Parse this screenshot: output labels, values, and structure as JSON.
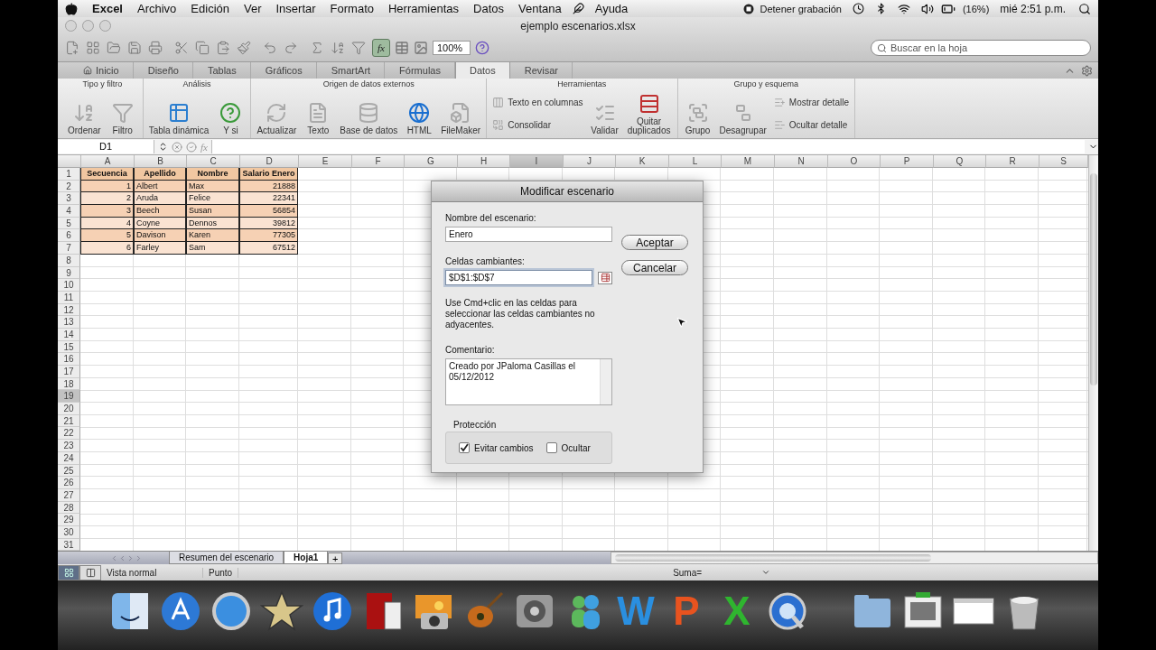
{
  "menu_bar": {
    "app": "Excel",
    "items": [
      "Archivo",
      "Edición",
      "Ver",
      "Insertar",
      "Formato",
      "Herramientas",
      "Datos",
      "Ventana",
      "Ayuda"
    ],
    "recording": "Detener grabación",
    "battery": "(16%)",
    "clock": "mié 2:51 p.m."
  },
  "window": {
    "title": "ejemplo escenarios.xlsx",
    "fx_label": "fx",
    "fx_pressed": true,
    "zoom": "100%",
    "search": {
      "placeholder": "Buscar en la hoja"
    }
  },
  "ribbon_tabs": [
    {
      "label": "Inicio",
      "selected": false
    },
    {
      "label": "Diseño",
      "selected": false
    },
    {
      "label": "Tablas",
      "selected": false
    },
    {
      "label": "Gráficos",
      "selected": false
    },
    {
      "label": "SmartArt",
      "selected": false
    },
    {
      "label": "Fórmulas",
      "selected": false
    },
    {
      "label": "Datos",
      "selected": true
    },
    {
      "label": "Revisar",
      "selected": false
    }
  ],
  "ribbon_groups": [
    {
      "title": "Tipo y filtro",
      "buttons": [
        {
          "label": "Ordenar",
          "kind": "large"
        },
        {
          "label": "Filtro",
          "kind": "large"
        }
      ]
    },
    {
      "title": "Análisis",
      "buttons": [
        {
          "label": "Tabla dinámica",
          "kind": "large"
        },
        {
          "label": "Y si",
          "kind": "large"
        }
      ]
    },
    {
      "title": "Origen de datos externos",
      "buttons": [
        {
          "label": "Actualizar",
          "kind": "large"
        },
        {
          "label": "Texto",
          "kind": "large"
        },
        {
          "label": "Base de datos",
          "kind": "large"
        },
        {
          "label": "HTML",
          "kind": "large"
        },
        {
          "label": "FileMaker",
          "kind": "large"
        }
      ]
    },
    {
      "title": "Herramientas",
      "buttons": [
        {
          "label": "Texto en columnas",
          "kind": "small"
        },
        {
          "label": "Consolidar",
          "kind": "small"
        },
        {
          "label": "Validar",
          "kind": "large"
        },
        {
          "label": "Quitar duplicados",
          "kind": "large"
        }
      ]
    },
    {
      "title": "Grupo y esquema",
      "buttons": [
        {
          "label": "Grupo",
          "kind": "large"
        },
        {
          "label": "Desagrupar",
          "kind": "large"
        },
        {
          "label": "Mostrar detalle",
          "kind": "small"
        },
        {
          "label": "Ocultar detalle",
          "kind": "small"
        }
      ]
    }
  ],
  "formula_bar": {
    "cell_ref": "D1",
    "fx_label": "fx"
  },
  "sheet": {
    "columns": [
      {
        "label": "A",
        "selected": false
      },
      {
        "label": "B",
        "selected": false
      },
      {
        "label": "C",
        "selected": false
      },
      {
        "label": "D",
        "selected": false
      },
      {
        "label": "E",
        "selected": false
      },
      {
        "label": "F",
        "selected": false
      },
      {
        "label": "G",
        "selected": false
      },
      {
        "label": "H",
        "selected": false
      },
      {
        "label": "I",
        "selected": true
      },
      {
        "label": "J",
        "selected": false
      },
      {
        "label": "K",
        "selected": false
      },
      {
        "label": "L",
        "selected": false
      },
      {
        "label": "M",
        "selected": false
      },
      {
        "label": "N",
        "selected": false
      },
      {
        "label": "O",
        "selected": false
      },
      {
        "label": "P",
        "selected": false
      },
      {
        "label": "Q",
        "selected": false
      },
      {
        "label": "R",
        "selected": false
      },
      {
        "label": "S",
        "selected": false
      }
    ],
    "row_headers": [
      {
        "label": "1",
        "selected": false
      },
      {
        "label": "2",
        "selected": false
      },
      {
        "label": "3",
        "selected": false
      },
      {
        "label": "4",
        "selected": false
      },
      {
        "label": "5",
        "selected": false
      },
      {
        "label": "6",
        "selected": false
      },
      {
        "label": "7",
        "selected": false
      },
      {
        "label": "8",
        "selected": false
      },
      {
        "label": "9",
        "selected": false
      },
      {
        "label": "10",
        "selected": false
      },
      {
        "label": "11",
        "selected": false
      },
      {
        "label": "12",
        "selected": false
      },
      {
        "label": "13",
        "selected": false
      },
      {
        "label": "14",
        "selected": false
      },
      {
        "label": "15",
        "selected": false
      },
      {
        "label": "16",
        "selected": false
      },
      {
        "label": "17",
        "selected": false
      },
      {
        "label": "18",
        "selected": false
      },
      {
        "label": "19",
        "selected": true
      },
      {
        "label": "20",
        "selected": false
      },
      {
        "label": "21",
        "selected": false
      },
      {
        "label": "22",
        "selected": false
      },
      {
        "label": "23",
        "selected": false
      },
      {
        "label": "24",
        "selected": false
      },
      {
        "label": "25",
        "selected": false
      },
      {
        "label": "26",
        "selected": false
      },
      {
        "label": "27",
        "selected": false
      },
      {
        "label": "28",
        "selected": false
      },
      {
        "label": "29",
        "selected": false
      },
      {
        "label": "30",
        "selected": false
      },
      {
        "label": "31",
        "selected": false
      }
    ],
    "table": {
      "columns": [
        "Secuencia",
        "Apellido",
        "Nombre",
        "Salario Enero"
      ],
      "rows": [
        [
          "1",
          "Albert",
          "Max",
          "21888"
        ],
        [
          "2",
          "Aruda",
          "Felice",
          "22341"
        ],
        [
          "3",
          "Beech",
          "Susan",
          "56854"
        ],
        [
          "4",
          "Coyne",
          "Dennos",
          "39812"
        ],
        [
          "5",
          "Davison",
          "Karen",
          "77305"
        ],
        [
          "6",
          "Farley",
          "Sam",
          "67512"
        ]
      ]
    }
  },
  "dialog": {
    "title": "Modificar escenario",
    "name_label": "Nombre del escenario:",
    "name_value": "Enero",
    "cells_label": "Celdas cambiantes:",
    "cells_value": "$D$1:$D$7",
    "hint": "Use Cmd+clic en las celdas para seleccionar las celdas cambiantes no adyacentes.",
    "comment_label": "Comentario:",
    "comment_value": "Creado por JPaloma Casillas el 05/12/2012",
    "protection_label": "Protección",
    "options": [
      {
        "label": "Evitar cambios",
        "checked": true
      },
      {
        "label": "Ocultar",
        "checked": false
      }
    ],
    "buttons": [
      "Aceptar",
      "Cancelar"
    ]
  },
  "sheet_tabs": [
    {
      "label": "Resumen del escenario",
      "selected": false
    },
    {
      "label": "Hoja1",
      "selected": true
    }
  ],
  "add_sheet": "+",
  "status_bar": {
    "view": "Vista normal",
    "mode": "Punto",
    "sum": "Suma="
  },
  "dock": [
    {
      "kind": "finder"
    },
    {
      "kind": "appstore"
    },
    {
      "kind": "safari"
    },
    {
      "kind": "star"
    },
    {
      "kind": "music"
    },
    {
      "kind": "curtain"
    },
    {
      "kind": "photo"
    },
    {
      "kind": "guitar"
    },
    {
      "kind": "gear"
    },
    {
      "kind": "people"
    },
    {
      "kind": "letter",
      "label": "W",
      "color": "#2a8fe0"
    },
    {
      "kind": "letter",
      "label": "P",
      "color": "#e8531f"
    },
    {
      "kind": "letter",
      "label": "X",
      "color": "#2fb52f"
    },
    {
      "kind": "quicktime"
    },
    {
      "kind": "folder"
    },
    {
      "kind": "monitor"
    },
    {
      "kind": "window"
    },
    {
      "kind": "trash"
    }
  ]
}
